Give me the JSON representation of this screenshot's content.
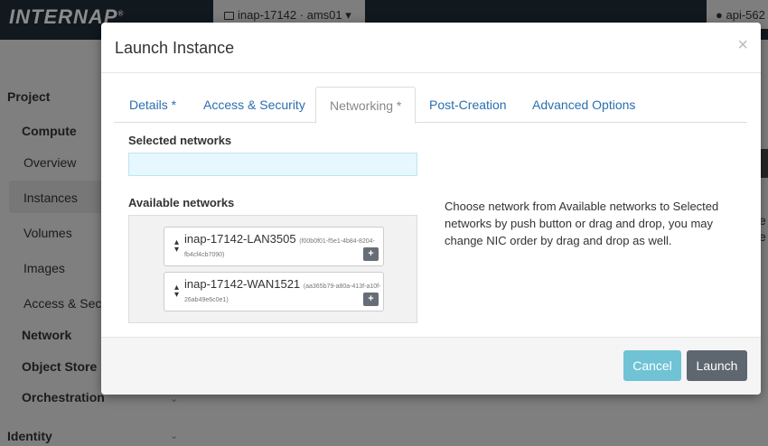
{
  "app": {
    "logo": "INTERNAP",
    "logo_mark": "®"
  },
  "header": {
    "project_selector": "inap-17142 · ams01 ▾",
    "user_menu": "api-562"
  },
  "sidebar": {
    "project": "Project",
    "compute": "Compute",
    "overview": "Overview",
    "instances": "Instances",
    "volumes": "Volumes",
    "images": "Images",
    "access_security": "Access & Secu",
    "network": "Network",
    "object_store": "Object Store",
    "orchestration": "Orchestration",
    "identity": "Identity"
  },
  "background_right": {
    "text1": "e",
    "text2": "e"
  },
  "modal": {
    "title": "Launch Instance",
    "close": "×",
    "tabs": [
      "Details *",
      "Access & Security",
      "Networking *",
      "Post-Creation",
      "Advanced Options"
    ],
    "active_tab": "Networking *",
    "selected_networks_label": "Selected networks",
    "available_networks_label": "Available networks",
    "networks": [
      {
        "name": "inap-17142-LAN3505",
        "id_part1": "(f00b0f01-f5e1-4b84-8204-",
        "id_part2": "fb4cf4cb7090)",
        "add": "+"
      },
      {
        "name": "inap-17142-WAN1521",
        "id_part1": "(aa365b79-a80a-413f-a10f-",
        "id_part2": "26ab49e6c0e1)",
        "add": "+"
      }
    ],
    "help_text": "Choose network from Available networks to Selected networks by push button or drag and drop, you may change NIC order by drag and drop as well.",
    "cancel_label": "Cancel",
    "launch_label": "Launch"
  },
  "colors": {
    "topbar": "#1f2c38",
    "link": "#2a6fb0",
    "cancel": "#6fc3d5",
    "launch": "#5e6670"
  }
}
